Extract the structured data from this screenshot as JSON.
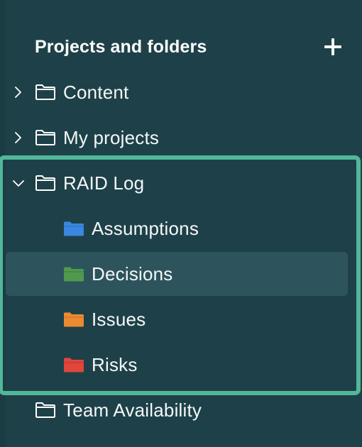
{
  "panel": {
    "title": "Projects and folders",
    "add_icon": "plus-icon"
  },
  "tree": {
    "content": {
      "label": "Content",
      "expanded": false,
      "chevron_icon": "chevron-right-icon",
      "folder_icon": "folder-outline-icon"
    },
    "my_projects": {
      "label": "My projects",
      "expanded": false,
      "chevron_icon": "chevron-right-icon",
      "folder_icon": "folder-outline-icon"
    },
    "raid_log": {
      "label": "RAID Log",
      "expanded": true,
      "chevron_icon": "chevron-down-icon",
      "folder_icon": "folder-outline-icon",
      "children": [
        {
          "label": "Assumptions",
          "color": "#3b86e0",
          "icon": "folder-blue-icon"
        },
        {
          "label": "Decisions",
          "color": "#4f9a4f",
          "icon": "folder-green-icon",
          "selected": true
        },
        {
          "label": "Issues",
          "color": "#ec8a31",
          "icon": "folder-orange-icon"
        },
        {
          "label": "Risks",
          "color": "#e0463c",
          "icon": "folder-red-icon"
        }
      ]
    },
    "team_availability": {
      "label": "Team Availability",
      "folder_icon": "folder-outline-icon"
    }
  },
  "colors": {
    "background": "#1e4149",
    "selected_row": "#2d545c",
    "highlight_border": "#52b79a",
    "text": "#ffffff"
  }
}
